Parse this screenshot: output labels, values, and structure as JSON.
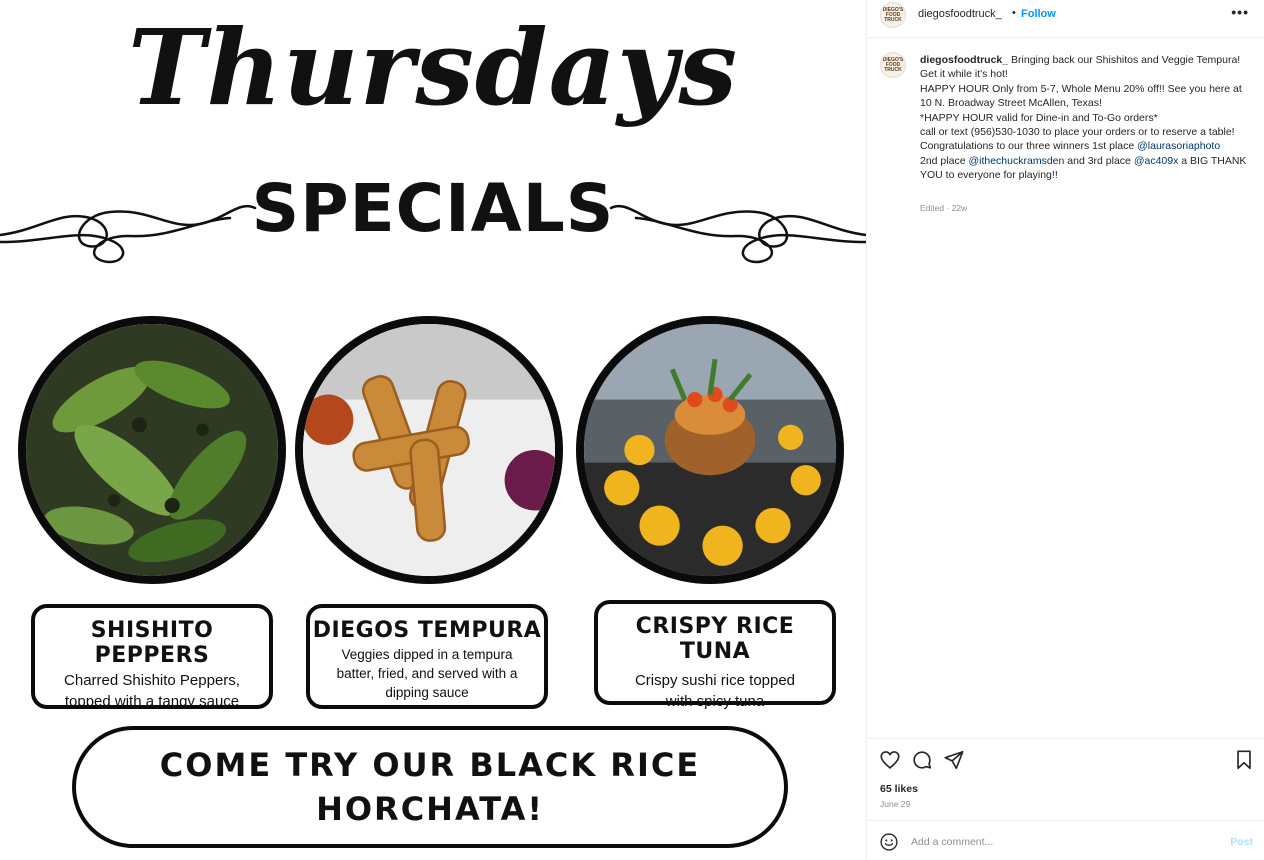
{
  "post_image": {
    "headline_script": "Thursdays",
    "headline_block": "SPECIALS",
    "dishes": [
      {
        "name": "SHISHITO PEPPERS",
        "description": "Charred Shishito Peppers, topped with a tangy sauce"
      },
      {
        "name": "DIEGOS TEMPURA",
        "description": "Veggies dipped in a tempura batter, fried, and served with a dipping sauce"
      },
      {
        "name": "CRISPY RICE TUNA",
        "description": "Crispy sushi rice topped with spicy tuna"
      }
    ],
    "banner": "COME TRY OUR BLACK RICE HORCHATA!"
  },
  "header": {
    "username": "diegosfoodtruck_",
    "separator": "•",
    "follow_label": "Follow",
    "more_icon": "more-horizontal-icon",
    "avatar_text": "DIEGO'S FOOD TRUCK"
  },
  "caption": {
    "username": "diegosfoodtruck_",
    "line1": "Bringing back our Shishitos and Veggie Tempura! Get it while it's hot!",
    "line2": "HAPPY HOUR Only from 5-7, Whole Menu 20% off!! See you here at 10 N. Broadway Street McAllen, Texas!",
    "line3": "*HAPPY HOUR valid for Dine-in and To-Go orders*",
    "line4": "call or text (956)530-1030 to place your orders or to reserve a table!",
    "line5_prefix": "Congratulations to our three winners 1st place",
    "mention1": "@laurasoriaphoto",
    "line5_mid1": "2nd place",
    "mention2": "@ithechuckramsden",
    "line5_mid2": "and 3rd place",
    "mention3": "@ac409x",
    "line5_suffix": "a BIG THANK YOU to everyone for playing!!",
    "meta": "Edited · 22w"
  },
  "actions": {
    "icons": [
      "heart-icon",
      "comment-icon",
      "share-icon",
      "bookmark-icon"
    ],
    "likes": "65 likes",
    "date": "June 29"
  },
  "comment": {
    "placeholder": "Add a comment...",
    "post_label": "Post",
    "emoji_icon": "emoji-icon"
  },
  "colors": {
    "accent": "#0095f6",
    "mention": "#00376b",
    "muted": "#8e8e8e",
    "post_disabled": "#b2dffc"
  }
}
